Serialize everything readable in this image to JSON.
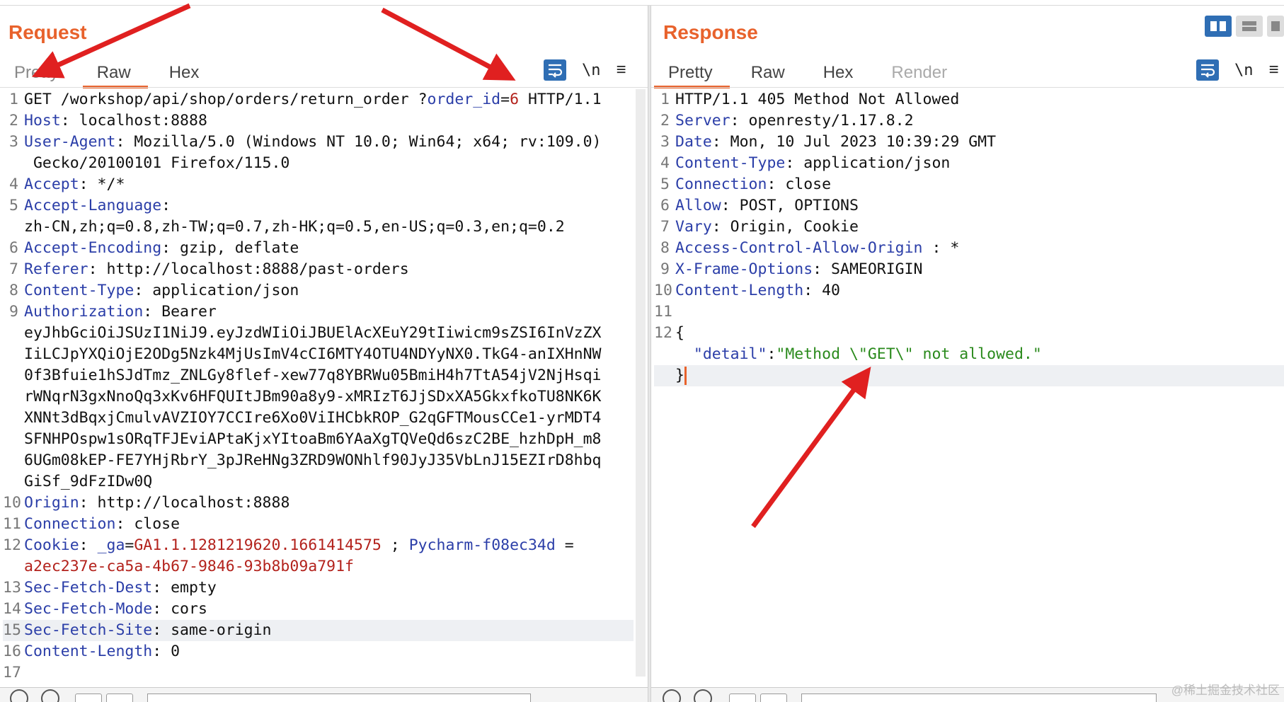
{
  "request": {
    "title": "Request",
    "tabs": [
      {
        "label": "Pretty"
      },
      {
        "label": "Raw"
      },
      {
        "label": "Hex"
      }
    ],
    "lines": [
      {
        "n": "1",
        "segs": [
          {
            "t": "GET /workshop/api/shop/orders/return_order ?",
            "c": "plain"
          },
          {
            "t": "order_id",
            "c": "blue"
          },
          {
            "t": "=",
            "c": "plain"
          },
          {
            "t": "6",
            "c": "red"
          },
          {
            "t": " HTTP/1.1",
            "c": "plain"
          }
        ]
      },
      {
        "n": "2",
        "segs": [
          {
            "t": "Host",
            "c": "hname"
          },
          {
            "t": ": localhost:8888",
            "c": "plain"
          }
        ]
      },
      {
        "n": "3",
        "segs": [
          {
            "t": "User-Agent",
            "c": "hname"
          },
          {
            "t": ": Mozilla/5.0 (Windows NT 10.0; Win64; x64; rv:109.0)",
            "c": "plain"
          }
        ]
      },
      {
        "n": "",
        "segs": [
          {
            "t": " Gecko/20100101 Firefox/115.0",
            "c": "plain"
          }
        ]
      },
      {
        "n": "4",
        "segs": [
          {
            "t": "Accept",
            "c": "hname"
          },
          {
            "t": ": */*",
            "c": "plain"
          }
        ]
      },
      {
        "n": "5",
        "segs": [
          {
            "t": "Accept-Language",
            "c": "hname"
          },
          {
            "t": ":",
            "c": "plain"
          }
        ]
      },
      {
        "n": "",
        "segs": [
          {
            "t": "zh-CN,zh;q=0.8,zh-TW;q=0.7,zh-HK;q=0.5,en-US;q=0.3,en;q=0.2",
            "c": "plain"
          }
        ]
      },
      {
        "n": "6",
        "segs": [
          {
            "t": "Accept-Encoding",
            "c": "hname"
          },
          {
            "t": ": gzip, deflate",
            "c": "plain"
          }
        ]
      },
      {
        "n": "7",
        "segs": [
          {
            "t": "Referer",
            "c": "hname"
          },
          {
            "t": ": http://localhost:8888/past-orders",
            "c": "plain"
          }
        ]
      },
      {
        "n": "8",
        "segs": [
          {
            "t": "Content-Type",
            "c": "hname"
          },
          {
            "t": ": application/json",
            "c": "plain"
          }
        ]
      },
      {
        "n": "9",
        "segs": [
          {
            "t": "Authorization",
            "c": "hname"
          },
          {
            "t": ": Bearer",
            "c": "plain"
          }
        ]
      },
      {
        "n": "",
        "segs": [
          {
            "t": "eyJhbGciOiJSUzI1NiJ9.eyJzdWIiOiJBUElAcXEuY29tIiwicm9sZSI6InVzZX",
            "c": "plain"
          }
        ]
      },
      {
        "n": "",
        "segs": [
          {
            "t": "IiLCJpYXQiOjE2ODg5Nzk4MjUsImV4cCI6MTY4OTU4NDYyNX0.TkG4-anIXHnNW",
            "c": "plain"
          }
        ]
      },
      {
        "n": "",
        "segs": [
          {
            "t": "0f3Bfuie1hSJdTmz_ZNLGy8flef-xew77q8YBRWu05BmiH4h7TtA54jV2NjHsqi",
            "c": "plain"
          }
        ]
      },
      {
        "n": "",
        "segs": [
          {
            "t": "rWNqrN3gxNnoQq3xKv6HFQUItJBm90a8y9-xMRIzT6JjSDxXA5GkxfkoTU8NK6K",
            "c": "plain"
          }
        ]
      },
      {
        "n": "",
        "segs": [
          {
            "t": "XNNt3dBqxjCmulvAVZIOY7CCIre6Xo0ViIHCbkROP_G2qGFTMousCCe1-yrMDT4",
            "c": "plain"
          }
        ]
      },
      {
        "n": "",
        "segs": [
          {
            "t": "SFNHPOspw1sORqTFJEviAPtaKjxYItoaBm6YAaXgTQVeQd6szC2BE_hzhDpH_m8",
            "c": "plain"
          }
        ]
      },
      {
        "n": "",
        "segs": [
          {
            "t": "6UGm08kEP-FE7YHjRbrY_3pJReHNg3ZRD9WONhlf90JyJ35VbLnJ15EZIrD8hbq",
            "c": "plain"
          }
        ]
      },
      {
        "n": "",
        "segs": [
          {
            "t": "GiSf_9dFzIDw0Q",
            "c": "plain"
          }
        ]
      },
      {
        "n": "10",
        "segs": [
          {
            "t": "Origin",
            "c": "hname"
          },
          {
            "t": ": http://localhost:8888",
            "c": "plain"
          }
        ]
      },
      {
        "n": "11",
        "segs": [
          {
            "t": "Connection",
            "c": "hname"
          },
          {
            "t": ": close",
            "c": "plain"
          }
        ]
      },
      {
        "n": "12",
        "segs": [
          {
            "t": "Cookie",
            "c": "hname"
          },
          {
            "t": ": ",
            "c": "plain"
          },
          {
            "t": "_ga",
            "c": "blue"
          },
          {
            "t": "=",
            "c": "plain"
          },
          {
            "t": "GA1.1.1281219620.1661414575",
            "c": "red"
          },
          {
            "t": " ; ",
            "c": "plain"
          },
          {
            "t": "Pycharm-f08ec34d",
            "c": "blue"
          },
          {
            "t": " =",
            "c": "plain"
          }
        ]
      },
      {
        "n": "",
        "segs": [
          {
            "t": "a2ec237e-ca5a-4b67-9846-93b8b09a791f",
            "c": "red"
          }
        ]
      },
      {
        "n": "13",
        "segs": [
          {
            "t": "Sec-Fetch-Dest",
            "c": "hname"
          },
          {
            "t": ": empty",
            "c": "plain"
          }
        ]
      },
      {
        "n": "14",
        "segs": [
          {
            "t": "Sec-Fetch-Mode",
            "c": "hname"
          },
          {
            "t": ": cors",
            "c": "plain"
          }
        ]
      },
      {
        "n": "15",
        "hl": true,
        "segs": [
          {
            "t": "Sec-Fetch-Site",
            "c": "hname"
          },
          {
            "t": ": same-origin",
            "c": "plain"
          }
        ]
      },
      {
        "n": "16",
        "segs": [
          {
            "t": "Content-Length",
            "c": "hname"
          },
          {
            "t": ": 0",
            "c": "plain"
          }
        ]
      },
      {
        "n": "17",
        "segs": []
      }
    ]
  },
  "response": {
    "title": "Response",
    "tabs": [
      {
        "label": "Pretty"
      },
      {
        "label": "Raw"
      },
      {
        "label": "Hex"
      },
      {
        "label": "Render"
      }
    ],
    "lines": [
      {
        "n": "1",
        "segs": [
          {
            "t": "HTTP/1.1 405 Method Not Allowed",
            "c": "plain"
          }
        ]
      },
      {
        "n": "2",
        "segs": [
          {
            "t": "Server",
            "c": "hname"
          },
          {
            "t": ": openresty/1.17.8.2",
            "c": "plain"
          }
        ]
      },
      {
        "n": "3",
        "segs": [
          {
            "t": "Date",
            "c": "hname"
          },
          {
            "t": ": Mon, 10 Jul 2023 10:39:29 GMT",
            "c": "plain"
          }
        ]
      },
      {
        "n": "4",
        "segs": [
          {
            "t": "Content-Type",
            "c": "hname"
          },
          {
            "t": ": application/json",
            "c": "plain"
          }
        ]
      },
      {
        "n": "5",
        "segs": [
          {
            "t": "Connection",
            "c": "hname"
          },
          {
            "t": ": close",
            "c": "plain"
          }
        ]
      },
      {
        "n": "6",
        "segs": [
          {
            "t": "Allow",
            "c": "hname"
          },
          {
            "t": ": POST, OPTIONS",
            "c": "plain"
          }
        ]
      },
      {
        "n": "7",
        "segs": [
          {
            "t": "Vary",
            "c": "hname"
          },
          {
            "t": ": Origin, Cookie",
            "c": "plain"
          }
        ]
      },
      {
        "n": "8",
        "segs": [
          {
            "t": "Access-Control-Allow-Origin",
            "c": "hname"
          },
          {
            "t": " : *",
            "c": "plain"
          }
        ]
      },
      {
        "n": "9",
        "segs": [
          {
            "t": "X-Frame-Options",
            "c": "hname"
          },
          {
            "t": ": SAMEORIGIN",
            "c": "plain"
          }
        ]
      },
      {
        "n": "10",
        "segs": [
          {
            "t": "Content-Length",
            "c": "hname"
          },
          {
            "t": ": 40",
            "c": "plain"
          }
        ]
      },
      {
        "n": "11",
        "segs": []
      },
      {
        "n": "12",
        "segs": [
          {
            "t": "{",
            "c": "plain"
          }
        ]
      },
      {
        "n": "",
        "segs": [
          {
            "t": "  \"detail\"",
            "c": "jsonkey"
          },
          {
            "t": ":",
            "c": "plain"
          },
          {
            "t": "\"Method \\\"GET\\\" not allowed.\"",
            "c": "jsonstr"
          }
        ]
      },
      {
        "n": "",
        "hl": true,
        "caret": true,
        "segs": [
          {
            "t": "}",
            "c": "plain"
          }
        ]
      }
    ]
  },
  "toolbar": {
    "newline_label": "\\n",
    "menu_label": "≡"
  },
  "watermark": "@稀土掘金技术社区",
  "colors": {
    "accent": "#e8622c",
    "button_blue": "#2f6eb4",
    "header_name": "#2b3ea8",
    "value_red": "#b3221c",
    "json_string": "#2a8a1c",
    "annotation_arrow": "#e02020"
  },
  "icons": [
    "word-wrap-icon",
    "newline-icon",
    "menu-icon",
    "layout-side-by-side-icon",
    "layout-stacked-icon",
    "layout-tabs-icon",
    "help-icon",
    "settings-gear-icon",
    "back-arrow-icon",
    "forward-arrow-icon"
  ]
}
